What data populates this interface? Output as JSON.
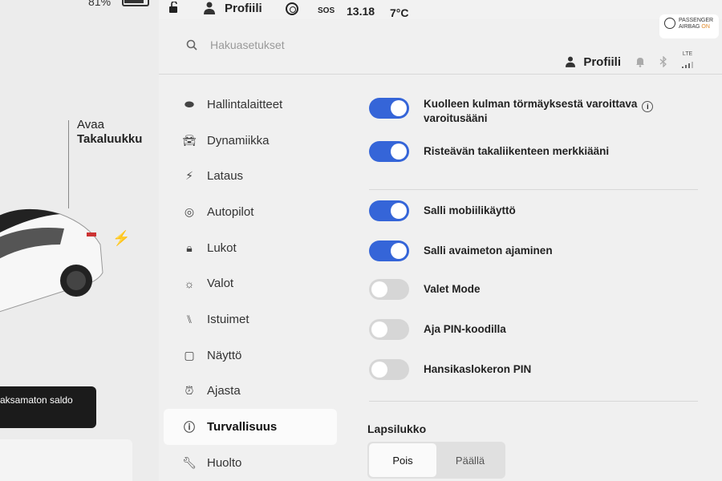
{
  "status_bar": {
    "battery": "81%",
    "profile": "Profiili",
    "sos": "SOS",
    "time": "13.18",
    "temperature": "7°C"
  },
  "car_view": {
    "trunk_line1": "Avaa",
    "trunk_line2": "Takaluukku",
    "balance": "aksamaton saldo"
  },
  "header": {
    "search_placeholder": "Hakuasetukset",
    "profile": "Profiili",
    "network": "LTE",
    "airbag_line1": "PASSENGER",
    "airbag_line2": "AIRBAG",
    "airbag_status": "ON"
  },
  "nav": [
    {
      "label": "Hallintalaitteet",
      "icon": "toggle-icon"
    },
    {
      "label": "Dynamiikka",
      "icon": "car-icon"
    },
    {
      "label": "Lataus",
      "icon": "bolt-icon"
    },
    {
      "label": "Autopilot",
      "icon": "steering-wheel-icon"
    },
    {
      "label": "Lukot",
      "icon": "lock-icon"
    },
    {
      "label": "Valot",
      "icon": "sun-icon"
    },
    {
      "label": "Istuimet",
      "icon": "seat-icon"
    },
    {
      "label": "Näyttö",
      "icon": "display-icon"
    },
    {
      "label": "Ajasta",
      "icon": "alarm-clock-icon"
    },
    {
      "label": "Turvallisuus",
      "icon": "alert-circle-icon",
      "active": true
    },
    {
      "label": "Huolto",
      "icon": "wrench-icon"
    }
  ],
  "toggles": [
    {
      "label_line1": "Kuolleen kulman törmäyksestä varoittava",
      "label_line2": "varoitusääni",
      "on": true
    },
    {
      "label_line1": "Risteävän takaliikenteen merkkiääni",
      "on": true
    },
    {
      "label_line1": "Salli mobiilikäyttö",
      "on": true
    },
    {
      "label_line1": "Salli avaimeton ajaminen",
      "on": true
    },
    {
      "label_line1": "Valet Mode",
      "on": false
    },
    {
      "label_line1": "Aja PIN-koodilla",
      "on": false
    },
    {
      "label_line1": "Hansikaslokeron PIN",
      "on": false
    }
  ],
  "child_lock": {
    "title": "Lapsilukko",
    "options": [
      "Pois",
      "Päällä"
    ],
    "selected": "Pois"
  },
  "colors": {
    "toggle_on": "#3565d8",
    "toggle_off": "#d6d6d6",
    "airbag_on": "#e08a2a"
  }
}
